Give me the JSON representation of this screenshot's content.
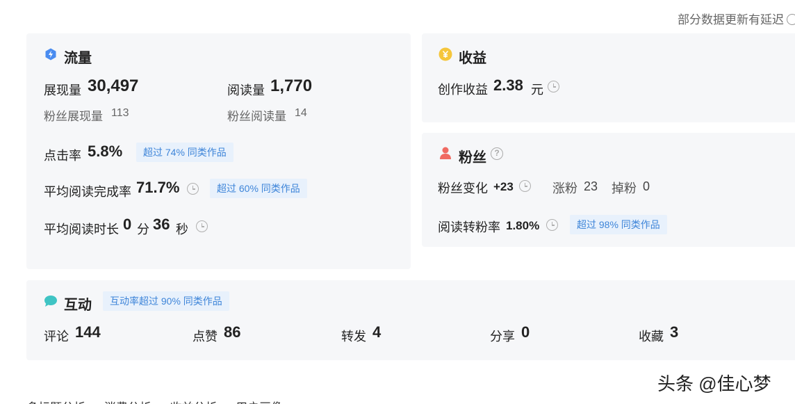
{
  "notice": "部分数据更新有延迟",
  "traffic": {
    "title": "流量",
    "impressions_label": "展现量",
    "impressions_value": "30,497",
    "reads_label": "阅读量",
    "reads_value": "1,770",
    "fan_impressions_label": "粉丝展现量",
    "fan_impressions_value": "113",
    "fan_reads_label": "粉丝阅读量",
    "fan_reads_value": "14",
    "ctr_label": "点击率",
    "ctr_value": "5.8%",
    "ctr_badge": "超过 74% 同类作品",
    "completion_label": "平均阅读完成率",
    "completion_value": "71.7%",
    "completion_badge": "超过 60% 同类作品",
    "duration_label": "平均阅读时长",
    "duration_min": "0",
    "duration_min_unit": "分",
    "duration_sec": "36",
    "duration_sec_unit": "秒"
  },
  "income": {
    "title": "收益",
    "creation_label": "创作收益",
    "creation_value": "2.38",
    "creation_unit": "元"
  },
  "fans": {
    "title": "粉丝",
    "change_label": "粉丝变化",
    "change_value": "+23",
    "gain_label": "涨粉",
    "gain_value": "23",
    "loss_label": "掉粉",
    "loss_value": "0",
    "conversion_label": "阅读转粉率",
    "conversion_value": "1.80%",
    "conversion_badge": "超过 98% 同类作品"
  },
  "interaction": {
    "title": "互动",
    "badge": "互动率超过 90% 同类作品",
    "items": [
      {
        "label": "评论",
        "value": "144"
      },
      {
        "label": "点赞",
        "value": "86"
      },
      {
        "label": "转发",
        "value": "4"
      },
      {
        "label": "分享",
        "value": "0"
      },
      {
        "label": "收藏",
        "value": "3"
      }
    ]
  },
  "watermark": "头条 @佳心梦",
  "bottom_tabs": "多标题分析 消费分析 收益分析 用户画像",
  "colors": {
    "traffic_icon": "#4a8cf0",
    "income_icon": "#f5c63c",
    "fans_icon": "#f06a62",
    "interact_icon": "#3fc4c4",
    "badge_text": "#3e85d9",
    "badge_bg": "#e8f1fc",
    "card_bg": "#f6f7f9"
  }
}
